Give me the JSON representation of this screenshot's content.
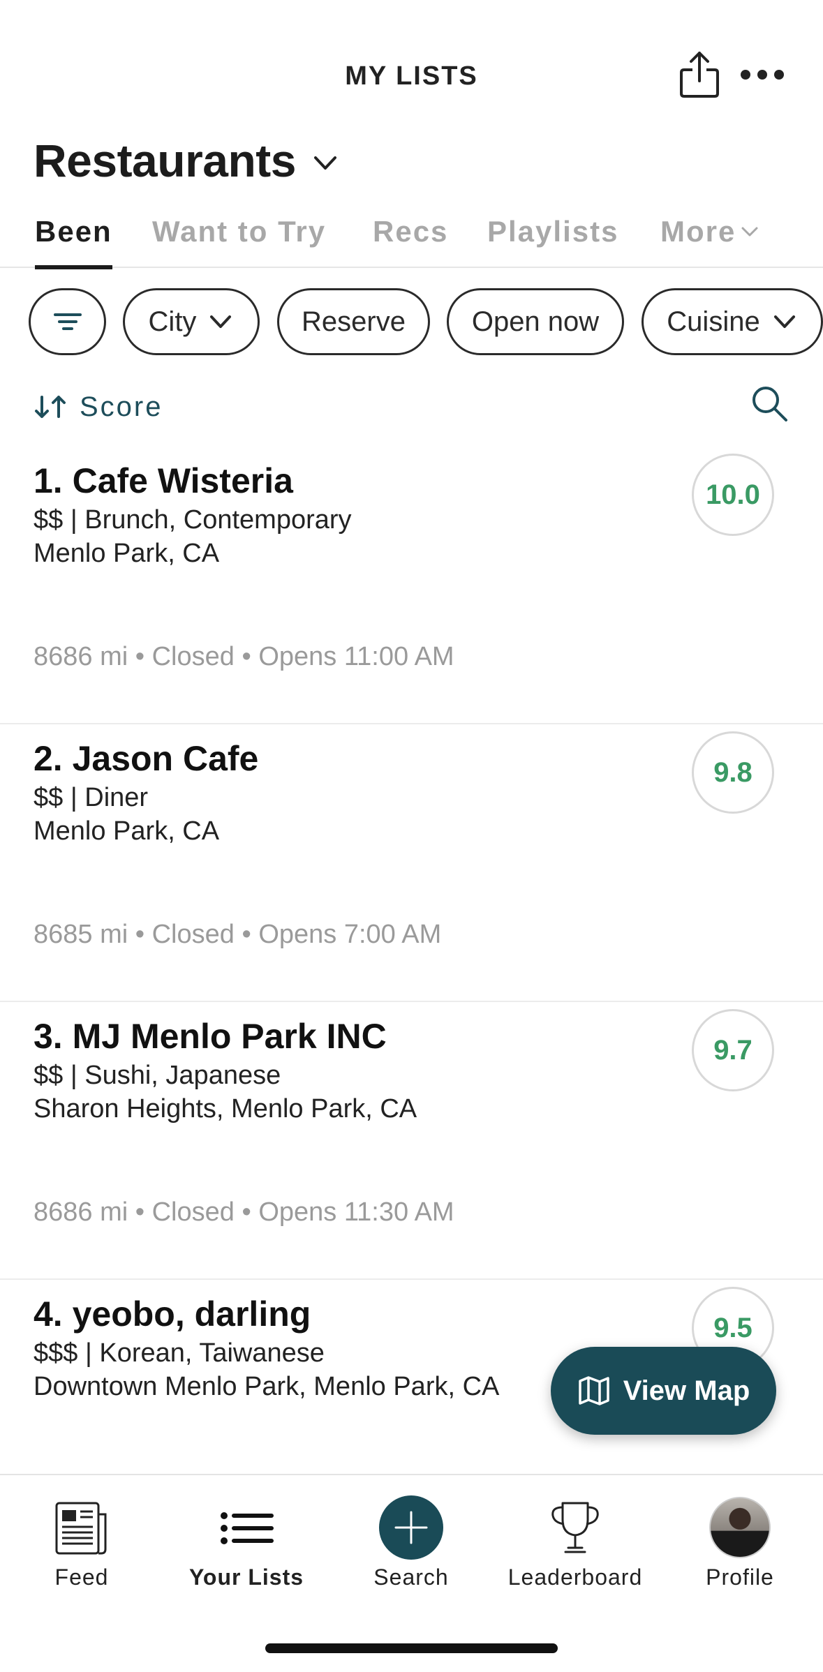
{
  "header": {
    "title": "MY LISTS",
    "list_name": "Restaurants",
    "icons": [
      "share-icon",
      "more-icon",
      "chevron-down-icon"
    ]
  },
  "tabs": [
    {
      "label": "Been",
      "active": true
    },
    {
      "label": "Want to Try",
      "active": false
    },
    {
      "label": "Recs",
      "active": false
    },
    {
      "label": "Playlists",
      "active": false
    },
    {
      "label": "More",
      "active": false
    }
  ],
  "filters": {
    "chips": [
      "City",
      "Reserve",
      "Open now",
      "Cuisine"
    ]
  },
  "sort": {
    "label": "Score"
  },
  "restaurants": [
    {
      "name": "1. Cafe Wisteria",
      "meta": "$$ | Brunch, Contemporary",
      "location": "Menlo Park, CA",
      "status": "8686 mi • Closed • Opens 11:00 AM",
      "score": "10.0"
    },
    {
      "name": "2. Jason Cafe",
      "meta": "$$ | Diner",
      "location": "Menlo Park, CA",
      "status": "8685 mi • Closed • Opens 7:00 AM",
      "score": "9.8"
    },
    {
      "name": "3. MJ Menlo Park INC",
      "meta": "$$ | Sushi, Japanese",
      "location": "Sharon Heights, Menlo Park, CA",
      "status": "8686 mi • Closed • Opens 11:30 AM",
      "score": "9.7"
    },
    {
      "name": "4. yeobo, darling",
      "meta": "$$$ | Korean, Taiwanese",
      "location": "Downtown Menlo Park, Menlo Park, CA",
      "status": "",
      "score": "9.5"
    }
  ],
  "view_map": {
    "label": "View Map"
  },
  "bottom_nav": [
    {
      "label": "Feed",
      "icon": "newspaper-icon"
    },
    {
      "label": "Your Lists",
      "icon": "list-icon",
      "active": true
    },
    {
      "label": "Search",
      "icon": "plus-circle-icon"
    },
    {
      "label": "Leaderboard",
      "icon": "trophy-icon"
    },
    {
      "label": "Profile",
      "icon": "avatar"
    }
  ],
  "colors": {
    "accent": "#1a4b57",
    "score_green": "#3a9a64",
    "muted": "#a8a8a8"
  }
}
